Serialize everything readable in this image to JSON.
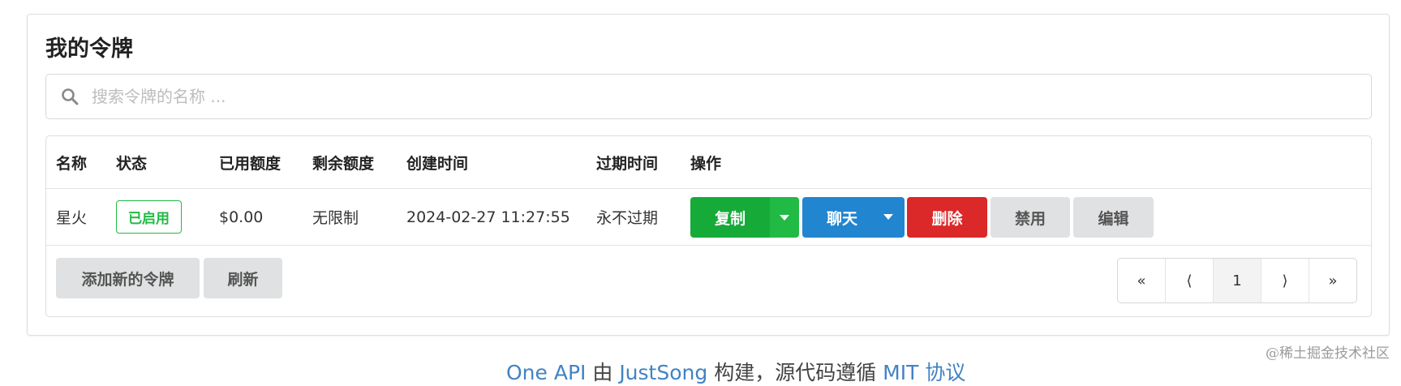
{
  "card": {
    "title": "我的令牌"
  },
  "search": {
    "placeholder": "搜索令牌的名称 ..."
  },
  "table": {
    "headers": [
      "名称",
      "状态",
      "已用额度",
      "剩余额度",
      "创建时间",
      "过期时间",
      "操作"
    ],
    "rows": [
      {
        "name": "星火",
        "status": "已启用",
        "used": "$0.00",
        "remaining": "无限制",
        "created": "2024-02-27 11:27:55",
        "expires": "永不过期"
      }
    ]
  },
  "actions": {
    "copy": "复制",
    "chat": "聊天",
    "delete": "删除",
    "disable": "禁用",
    "edit": "编辑"
  },
  "footer_buttons": {
    "add": "添加新的令牌",
    "refresh": "刷新"
  },
  "pagination": {
    "first": "«",
    "prev": "⟨",
    "current": "1",
    "next": "⟩",
    "last": "»"
  },
  "footer": {
    "p1": "One API",
    "p2": " 由 ",
    "p3": "JustSong",
    "p4": " 构建，源代码遵循 ",
    "p5": "MIT 协议"
  },
  "watermark": "@稀土掘金技术社区",
  "colors": {
    "green": "#16ab39",
    "blue": "#2185d0",
    "red": "#db2828",
    "grey": "#e0e1e2",
    "link": "#4183c4"
  }
}
